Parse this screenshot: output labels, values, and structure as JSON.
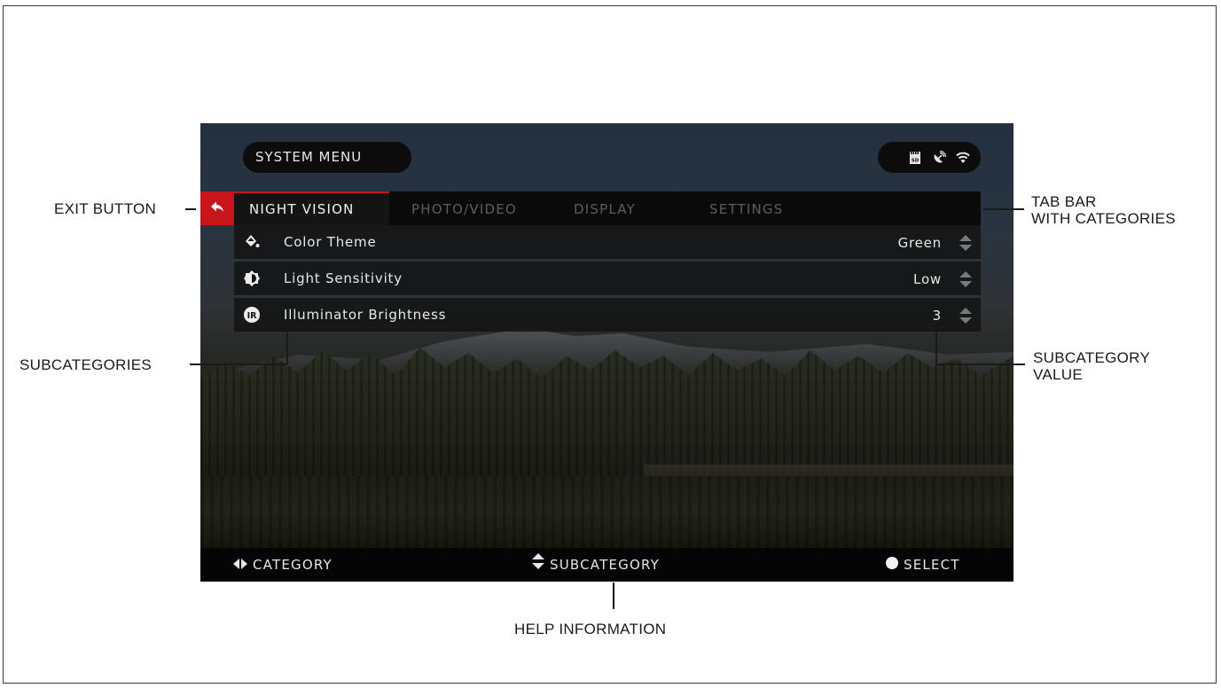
{
  "screen": {
    "menu_title": "SYSTEM MENU",
    "status_icons": [
      "sd-card-icon",
      "gps-icon",
      "wifi-icon"
    ],
    "tabs": [
      {
        "label": "NIGHT VISION",
        "active": true
      },
      {
        "label": "PHOTO/VIDEO",
        "active": false
      },
      {
        "label": "DISPLAY",
        "active": false
      },
      {
        "label": "SETTINGS",
        "active": false
      }
    ],
    "exit_icon": "back-arrow-icon",
    "rows": [
      {
        "icon": "paint-bucket-icon",
        "label": "Color Theme",
        "value": "Green"
      },
      {
        "icon": "contrast-icon",
        "label": "Light Sensitivity",
        "value": "Low"
      },
      {
        "icon": "ir-icon",
        "label": "Illuminator Brightness",
        "value": "3"
      }
    ],
    "help": [
      {
        "icon": "left-right-arrows-icon",
        "label": "CATEGORY"
      },
      {
        "icon": "up-down-arrows-icon",
        "label": "SUBCATEGORY"
      },
      {
        "icon": "dot-icon",
        "label": "SELECT"
      }
    ],
    "colors": {
      "accent": "#c8151b",
      "bar": "#0a0a0a",
      "text": "#e8e8e8",
      "inactive_tab": "#5d5d5d"
    }
  },
  "annotations": {
    "exit_button": "EXIT BUTTON",
    "tab_bar_line1": "TAB BAR",
    "tab_bar_line2": "WITH CATEGORIES",
    "subcategories": "SUBCATEGORIES",
    "subcategory_value_line1": "SUBCATEGORY",
    "subcategory_value_line2": "VALUE",
    "help_information": "HELP INFORMATION"
  }
}
